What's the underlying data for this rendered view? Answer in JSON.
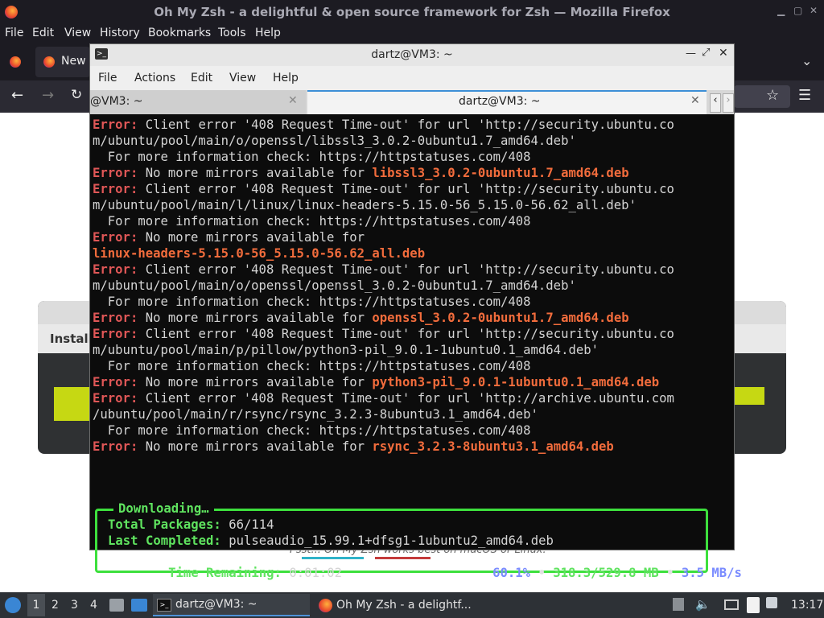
{
  "browser": {
    "title": "Oh My Zsh - a delightful & open source framework for Zsh — Mozilla Firefox",
    "menu": [
      "File",
      "Edit",
      "View",
      "History",
      "Bookmarks",
      "Tools",
      "Help"
    ],
    "tab_label": "New",
    "controls": [
      "minimize-icon",
      "maximize-icon",
      "close-icon"
    ]
  },
  "page": {
    "install_label": "Install",
    "psst": "Psst... Oh My Zsh works best on macOS or Linux."
  },
  "terminal": {
    "title": "dartz@VM3: ~",
    "menu": [
      "File",
      "Actions",
      "Edit",
      "View",
      "Help"
    ],
    "tabs": [
      {
        "label": "@VM3: ~"
      },
      {
        "label": "dartz@VM3: ~"
      }
    ],
    "lines": [
      {
        "type": "err",
        "a": "Error:",
        "b": " Client error '408 Request Time-out' for url 'http://security.ubuntu.co"
      },
      {
        "type": "plain",
        "b": "m/ubuntu/pool/main/o/openssl/libssl3_3.0.2-0ubuntu1.7_amd64.deb'"
      },
      {
        "type": "plain",
        "b": "  For more information check: https://httpstatuses.com/408"
      },
      {
        "type": "mirror",
        "a": "Error:",
        "b": " No more mirrors available for ",
        "c": "libssl3_3.0.2-0ubuntu1.7_amd64.deb"
      },
      {
        "type": "err",
        "a": "Error:",
        "b": " Client error '408 Request Time-out' for url 'http://security.ubuntu.co"
      },
      {
        "type": "plain",
        "b": "m/ubuntu/pool/main/l/linux/linux-headers-5.15.0-56_5.15.0-56.62_all.deb'"
      },
      {
        "type": "plain",
        "b": "  For more information check: https://httpstatuses.com/408"
      },
      {
        "type": "err",
        "a": "Error:",
        "b": " No more mirrors available for"
      },
      {
        "type": "pkgonly",
        "c": "linux-headers-5.15.0-56_5.15.0-56.62_all.deb"
      },
      {
        "type": "err",
        "a": "Error:",
        "b": " Client error '408 Request Time-out' for url 'http://security.ubuntu.co"
      },
      {
        "type": "plain",
        "b": "m/ubuntu/pool/main/o/openssl/openssl_3.0.2-0ubuntu1.7_amd64.deb'"
      },
      {
        "type": "plain",
        "b": "  For more information check: https://httpstatuses.com/408"
      },
      {
        "type": "mirror",
        "a": "Error:",
        "b": " No more mirrors available for ",
        "c": "openssl_3.0.2-0ubuntu1.7_amd64.deb"
      },
      {
        "type": "err",
        "a": "Error:",
        "b": " Client error '408 Request Time-out' for url 'http://security.ubuntu.co"
      },
      {
        "type": "plain",
        "b": "m/ubuntu/pool/main/p/pillow/python3-pil_9.0.1-1ubuntu0.1_amd64.deb'"
      },
      {
        "type": "plain",
        "b": "  For more information check: https://httpstatuses.com/408"
      },
      {
        "type": "mirror",
        "a": "Error:",
        "b": " No more mirrors available for ",
        "c": "python3-pil_9.0.1-1ubuntu0.1_amd64.deb"
      },
      {
        "type": "err",
        "a": "Error:",
        "b": " Client error '408 Request Time-out' for url 'http://archive.ubuntu.com"
      },
      {
        "type": "plain",
        "b": "/ubuntu/pool/main/r/rsync/rsync_3.2.3-8ubuntu3.1_amd64.deb'"
      },
      {
        "type": "plain",
        "b": "  For more information check: https://httpstatuses.com/408"
      },
      {
        "type": "mirror",
        "a": "Error:",
        "b": " No more mirrors available for ",
        "c": "rsync_3.2.3-8ubuntu3.1_amd64.deb"
      }
    ],
    "download": {
      "heading": "Downloading…",
      "total_label": "Total Packages:",
      "total_value": "66/114",
      "last_label": "Last Completed:",
      "last_value": "pulseaudio_15.99.1+dfsg1-1ubuntu2_amd64.deb",
      "remaining_label": "Time Remaining:",
      "remaining_value": "0:01:02",
      "percent": "60.1%",
      "progress_fraction": 0.601,
      "size": "318.3/529.8 MB",
      "speed": "3.5 MB/s",
      "sep": "•"
    }
  },
  "taskbar": {
    "workspaces": [
      "1",
      "2",
      "3",
      "4"
    ],
    "terminal_task": "dartz@VM3: ~",
    "firefox_task": "Oh My Zsh - a delightf...",
    "clock": "13:17"
  },
  "colors": {
    "error": "#e05757",
    "package": "#f26c3c",
    "frame_green": "#3de03d",
    "percent_blue": "#7a8cff"
  }
}
